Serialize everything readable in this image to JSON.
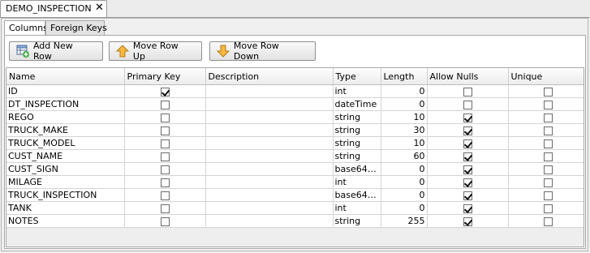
{
  "document_tab": {
    "title": "DEMO_INSPECTION"
  },
  "subtabs": [
    {
      "label": "Columns"
    },
    {
      "label": "Foreign Keys"
    }
  ],
  "toolbar": {
    "add_label": "Add New Row",
    "up_label": "Move Row Up",
    "down_label": "Move Row Down"
  },
  "columns_table": {
    "headers": [
      "Name",
      "Primary Key",
      "Description",
      "Type",
      "Length",
      "Allow Nulls",
      "Unique"
    ],
    "rows": [
      {
        "name": "ID",
        "primary_key": true,
        "description": "",
        "type": "int",
        "length": "0",
        "allow_nulls": false,
        "unique": false
      },
      {
        "name": "DT_INSPECTION",
        "primary_key": false,
        "description": "",
        "type": "dateTime",
        "length": "0",
        "allow_nulls": false,
        "unique": false
      },
      {
        "name": "REGO",
        "primary_key": false,
        "description": "",
        "type": "string",
        "length": "10",
        "allow_nulls": true,
        "unique": false
      },
      {
        "name": "TRUCK_MAKE",
        "primary_key": false,
        "description": "",
        "type": "string",
        "length": "30",
        "allow_nulls": true,
        "unique": false
      },
      {
        "name": "TRUCK_MODEL",
        "primary_key": false,
        "description": "",
        "type": "string",
        "length": "10",
        "allow_nulls": true,
        "unique": false
      },
      {
        "name": "CUST_NAME",
        "primary_key": false,
        "description": "",
        "type": "string",
        "length": "60",
        "allow_nulls": true,
        "unique": false
      },
      {
        "name": "CUST_SIGN",
        "primary_key": false,
        "description": "",
        "type": "base64Binary",
        "length": "0",
        "allow_nulls": true,
        "unique": false
      },
      {
        "name": "MILAGE",
        "primary_key": false,
        "description": "",
        "type": "int",
        "length": "0",
        "allow_nulls": true,
        "unique": false
      },
      {
        "name": "TRUCK_INSPECTION",
        "primary_key": false,
        "description": "",
        "type": "base64Binary",
        "length": "0",
        "allow_nulls": true,
        "unique": false
      },
      {
        "name": "TANK",
        "primary_key": false,
        "description": "",
        "type": "int",
        "length": "0",
        "allow_nulls": true,
        "unique": false
      },
      {
        "name": "NOTES",
        "primary_key": false,
        "description": "",
        "type": "string",
        "length": "255",
        "allow_nulls": true,
        "unique": false
      }
    ]
  }
}
